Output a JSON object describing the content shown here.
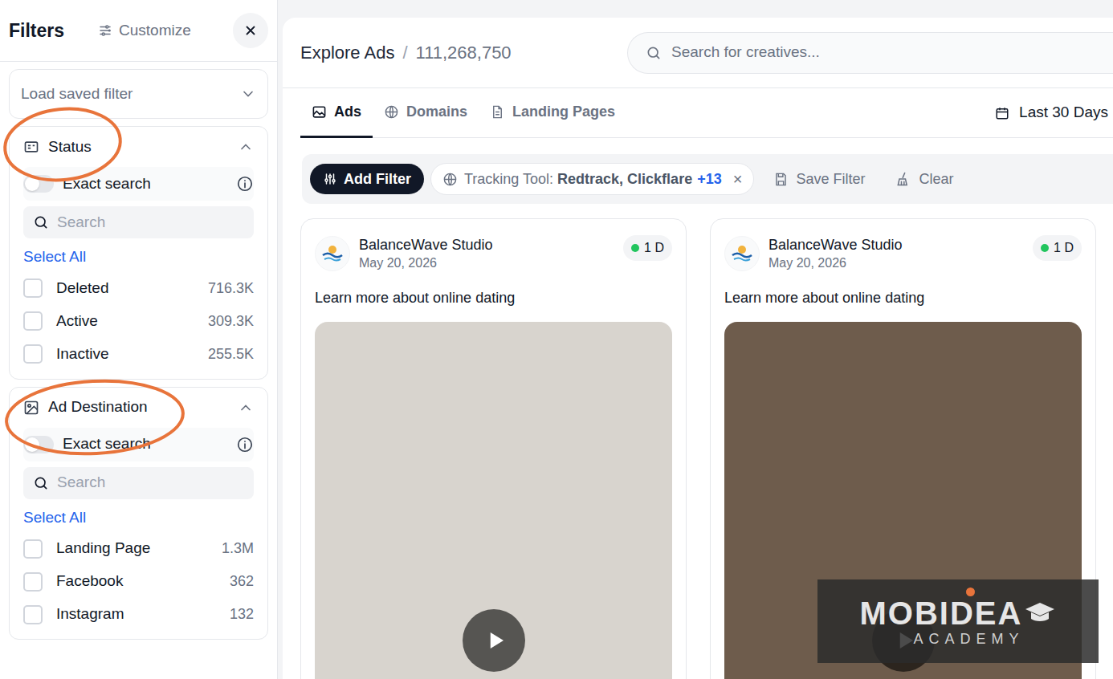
{
  "filters": {
    "title": "Filters",
    "customize": "Customize",
    "load_saved": "Load saved filter",
    "sections": [
      {
        "title": "Status",
        "expanded": true,
        "exact_search": {
          "label": "Exact search",
          "on": false
        },
        "search_placeholder": "Search",
        "select_all": "Select All",
        "options": [
          {
            "label": "Deleted",
            "count": "716.3K",
            "checked": false
          },
          {
            "label": "Active",
            "count": "309.3K",
            "checked": false
          },
          {
            "label": "Inactive",
            "count": "255.5K",
            "checked": false
          }
        ]
      },
      {
        "title": "Ad Destination",
        "expanded": true,
        "exact_search": {
          "label": "Exact search",
          "on": false
        },
        "search_placeholder": "Search",
        "select_all": "Select All",
        "options": [
          {
            "label": "Landing Page",
            "count": "1.3M",
            "checked": false
          },
          {
            "label": "Facebook",
            "count": "362",
            "checked": false
          },
          {
            "label": "Instagram",
            "count": "132",
            "checked": false
          }
        ]
      }
    ]
  },
  "explore": {
    "title": "Explore Ads",
    "separator": "/",
    "count": "111,268,750",
    "search_placeholder": "Search for creatives..."
  },
  "tabs": [
    {
      "label": "Ads",
      "selected": true
    },
    {
      "label": "Domains",
      "selected": false
    },
    {
      "label": "Landing Pages",
      "selected": false
    }
  ],
  "date_range": "Last 30 Days",
  "filter_bar": {
    "add_filter": "Add Filter",
    "chip": {
      "label": "Tracking Tool:",
      "value": "Redtrack, Clickflare",
      "more": "+13",
      "remove": "×"
    },
    "save": "Save Filter",
    "clear": "Clear"
  },
  "ads": [
    {
      "advertiser": "BalanceWave Studio",
      "date": "May 20, 2026",
      "badge": "1 D",
      "active": true,
      "text": "Learn more about online dating"
    },
    {
      "advertiser": "BalanceWave Studio",
      "date": "May 20, 2026",
      "badge": "1 D",
      "active": true,
      "text": "Learn more about online dating"
    }
  ],
  "watermark": {
    "title": "MOBIDEA",
    "subtitle": "ACADEMY"
  }
}
